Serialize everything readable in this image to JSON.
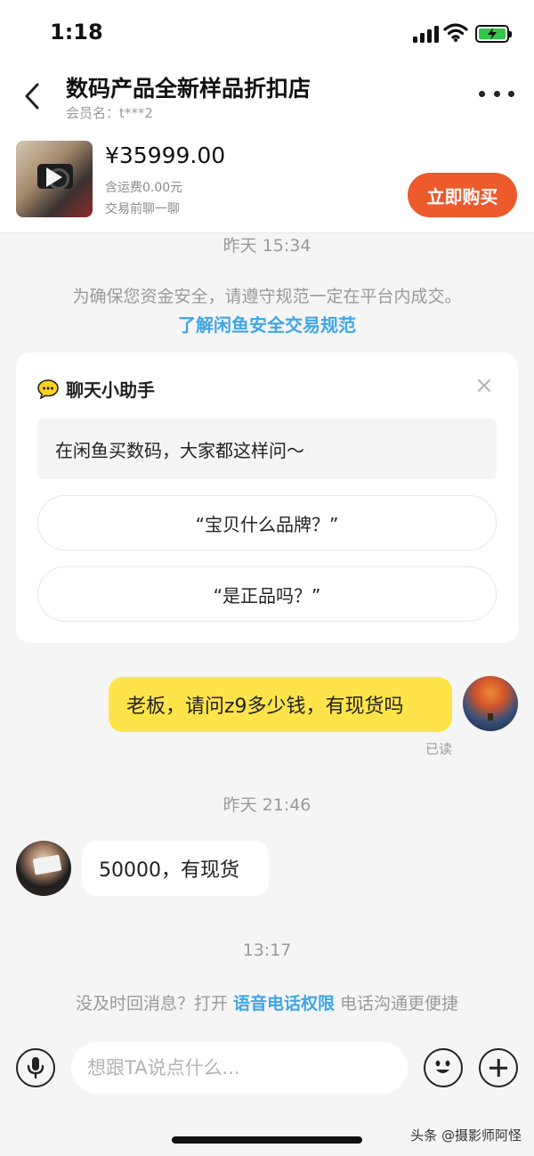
{
  "status_bar": {
    "time": "1:18"
  },
  "header": {
    "title": "数码产品全新样品折扣店",
    "member_name": "会员名：t***2"
  },
  "product": {
    "price": "¥35999.00",
    "shipping": "含运费0.00元",
    "note": "交易前聊一聊",
    "buy_label": "立即购买"
  },
  "chat": {
    "timestamp_1": "昨天 15:34",
    "notice": "为确保您资金安全，请遵守规范一定在平台内成交。",
    "notice_link": "了解闲鱼安全交易规范",
    "assistant": {
      "title": "聊天小助手",
      "prompt": "在闲鱼买数码，大家都这样问～",
      "questions": [
        "“宝贝什么品牌？”",
        "“是正品吗？”"
      ]
    },
    "my_message": "老板，请问z9多少钱，有现货吗",
    "read_status": "已读",
    "timestamp_2": "昨天 21:46",
    "their_message": "50000，有现货",
    "timestamp_3": "13:17",
    "tip_before": "没及时回消息？打开 ",
    "tip_link": "语音电话权限",
    "tip_after": " 电话沟通更便捷"
  },
  "input": {
    "placeholder": "想跟TA说点什么..."
  },
  "watermark": "头条 @摄影师阿怪",
  "colors": {
    "accent_orange": "#ed5a2c",
    "my_bubble": "#ffe449",
    "link_blue": "#3ea6e6",
    "background": "#f5f5f5"
  }
}
